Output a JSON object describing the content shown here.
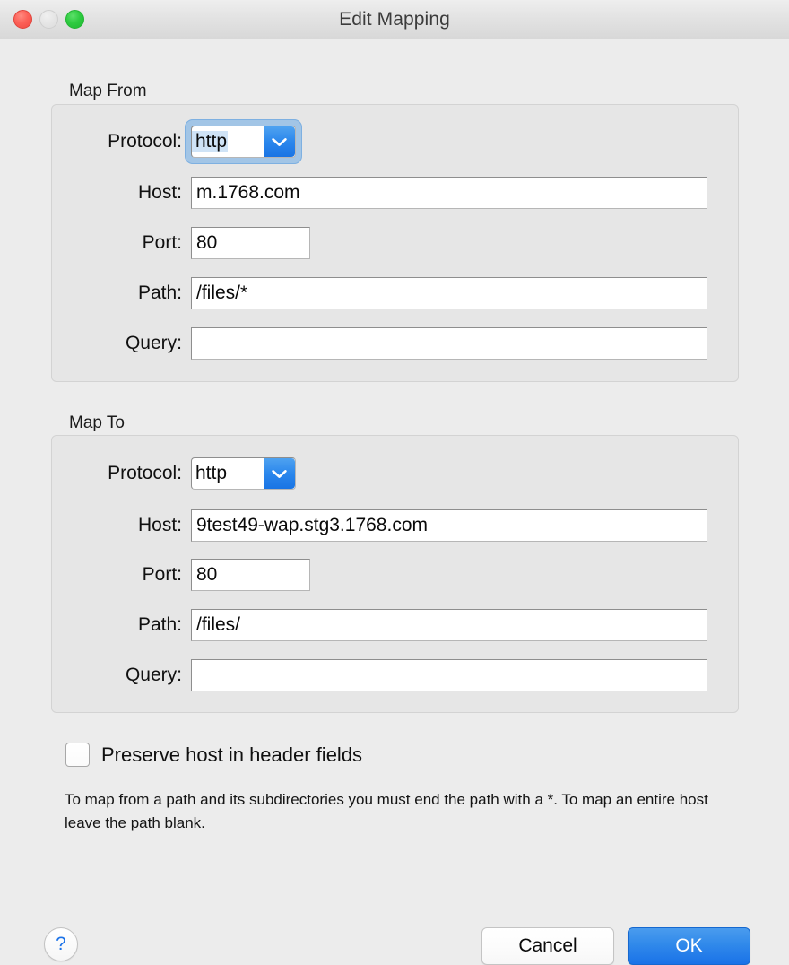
{
  "window": {
    "title": "Edit Mapping",
    "traffic_lights": {
      "close": "close-button",
      "minimize": "minimize-button",
      "zoom": "zoom-button"
    }
  },
  "map_from": {
    "group_title": "Map From",
    "protocol": {
      "label": "Protocol:",
      "value": "http",
      "focused": true,
      "text_selected": true
    },
    "host": {
      "label": "Host:",
      "value": "m.1768.com"
    },
    "port": {
      "label": "Port:",
      "value": "80"
    },
    "path": {
      "label": "Path:",
      "value": "/files/*"
    },
    "query": {
      "label": "Query:",
      "value": ""
    }
  },
  "map_to": {
    "group_title": "Map To",
    "protocol": {
      "label": "Protocol:",
      "value": "http",
      "focused": false,
      "text_selected": false
    },
    "host": {
      "label": "Host:",
      "value": "9test49-wap.stg3.1768.com"
    },
    "port": {
      "label": "Port:",
      "value": "80"
    },
    "path": {
      "label": "Path:",
      "value": "/files/"
    },
    "query": {
      "label": "Query:",
      "value": ""
    }
  },
  "options": {
    "preserve_host": {
      "label": "Preserve host in header fields",
      "checked": false
    }
  },
  "help_text": "To map from a path and its subdirectories you must end the path with a *. To map an entire host leave the path blank.",
  "footer": {
    "help_label": "?",
    "cancel_label": "Cancel",
    "ok_label": "OK"
  },
  "colors": {
    "accent_blue": "#1a72e8",
    "popup_arrow_blue": "#2a86ec",
    "focus_ring": "#6aa9e5",
    "selection_blue": "#cfe3f6",
    "window_bg": "#ececec",
    "group_bg": "#e6e6e6",
    "close_red": "#fc6158",
    "minimize_gray": "#e4e4e4",
    "zoom_green": "#2ecb40"
  }
}
